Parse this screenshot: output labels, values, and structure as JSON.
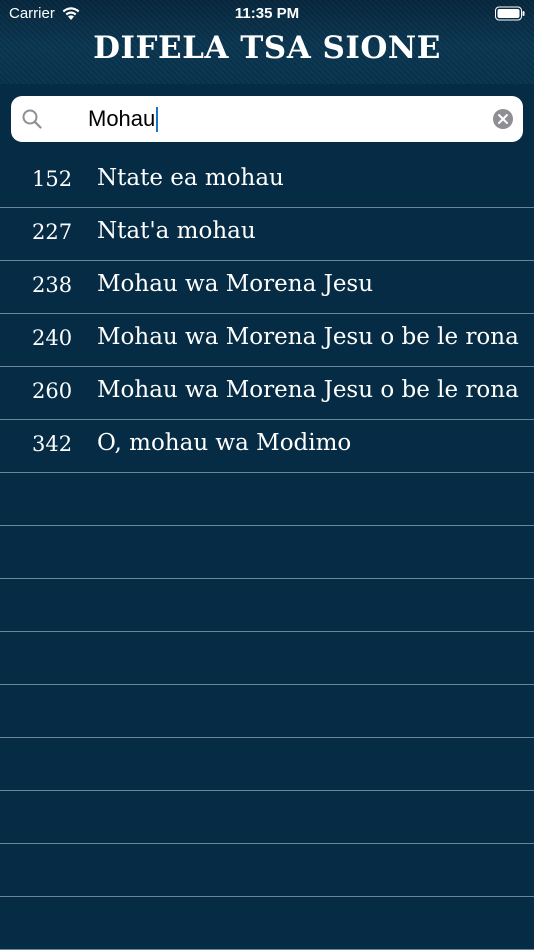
{
  "status_bar": {
    "carrier": "Carrier",
    "time": "11:35 PM",
    "wifi_icon": "wifi-icon",
    "battery_icon": "battery-icon"
  },
  "header": {
    "title": "DIFELA TSA SIONE"
  },
  "search": {
    "value": "Mohau",
    "search_icon": "search-icon",
    "clear_icon": "clear-icon"
  },
  "colors": {
    "background": "#052c44",
    "header": "#0a3550",
    "separator": "#6b8599",
    "caret": "#1a74c4",
    "text": "#ffffff"
  },
  "results": [
    {
      "number": "152",
      "title": "Ntate ea mohau"
    },
    {
      "number": "227",
      "title": "Ntat'a mohau"
    },
    {
      "number": "238",
      "title": "Mohau wa Morena Jesu"
    },
    {
      "number": "240",
      "title": "Mohau wa Morena Jesu o be le rona"
    },
    {
      "number": "260",
      "title": "Mohau wa Morena Jesu o be le rona"
    },
    {
      "number": "342",
      "title": "O, mohau wa Modimo"
    },
    {
      "number": "",
      "title": ""
    },
    {
      "number": "",
      "title": ""
    },
    {
      "number": "",
      "title": ""
    },
    {
      "number": "",
      "title": ""
    },
    {
      "number": "",
      "title": ""
    },
    {
      "number": "",
      "title": ""
    },
    {
      "number": "",
      "title": ""
    },
    {
      "number": "",
      "title": ""
    },
    {
      "number": "",
      "title": ""
    }
  ]
}
